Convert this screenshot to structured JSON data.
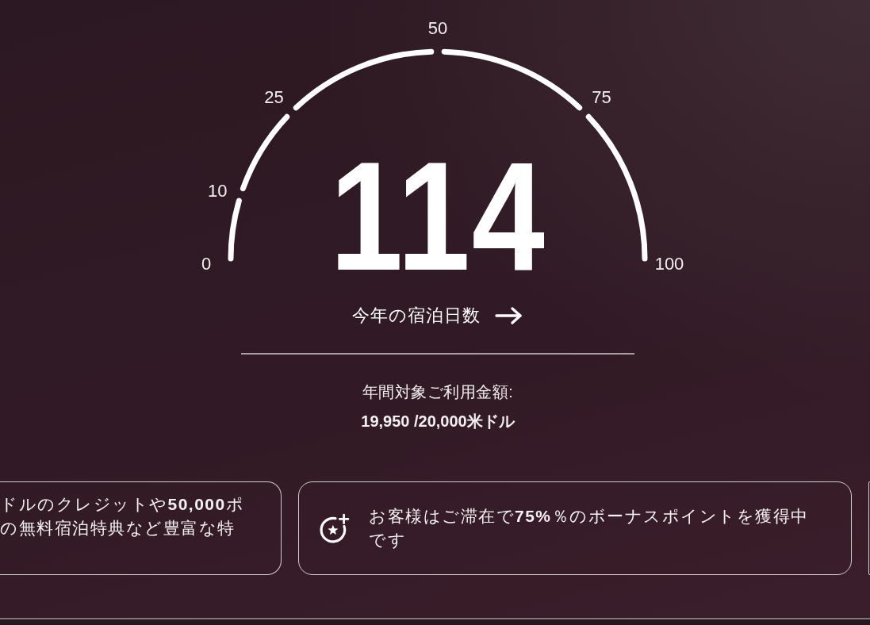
{
  "gauge": {
    "value": "114",
    "level": 1,
    "ticks": [
      "0",
      "10",
      "25",
      "50",
      "75",
      "100"
    ]
  },
  "nights_link": {
    "label": "今年の宿泊日数"
  },
  "spend": {
    "label": "年間対象ご利用金額:",
    "value": "19,950 /20,000米ドル"
  },
  "cards": [
    {
      "kind": "clipped",
      "lines": [
        "ドルのクレジットや**50,000**ポ",
        "の無料宿泊特典など豊富な特"
      ]
    },
    {
      "kind": "icon",
      "text": "お客様はご滞在で**75%**％のボーナスポイントを獲得中です"
    }
  ]
}
